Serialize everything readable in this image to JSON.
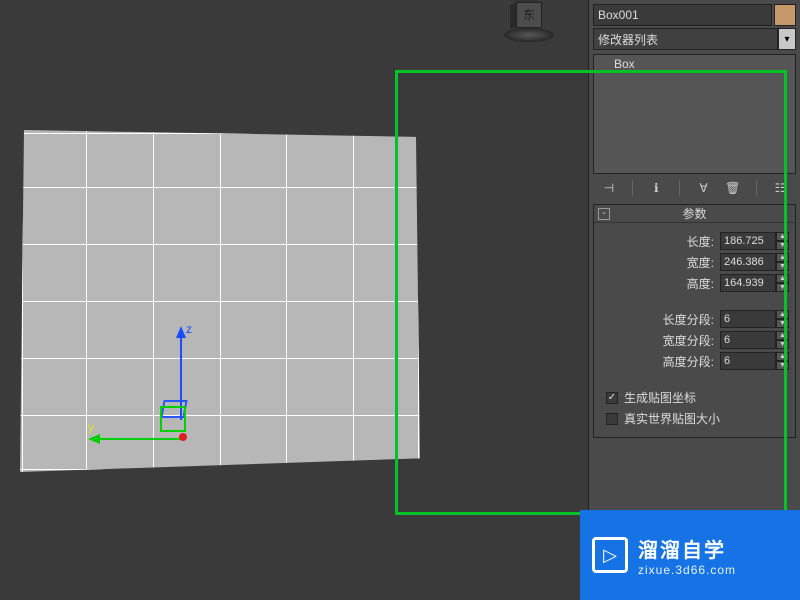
{
  "orient": {
    "face_label": "东"
  },
  "side": {
    "object_name": "Box001",
    "modifier_dd": "修改器列表",
    "modifier_stack": [
      "Box"
    ],
    "rollout_title": "参数",
    "params": {
      "length_label": "长度:",
      "length_value": "186.725",
      "width_label": "宽度:",
      "width_value": "246.386",
      "height_label": "高度:",
      "height_value": "164.939",
      "lseg_label": "长度分段:",
      "lseg_value": "6",
      "wseg_label": "宽度分段:",
      "wseg_value": "6",
      "hseg_label": "高度分段:",
      "hseg_value": "6"
    },
    "checks": {
      "genmap_label": "生成贴图坐标",
      "realworld_label": "真实世界贴图大小"
    }
  },
  "wm": {
    "title": "溜溜自学",
    "sub": "zixue.3d66.com"
  }
}
